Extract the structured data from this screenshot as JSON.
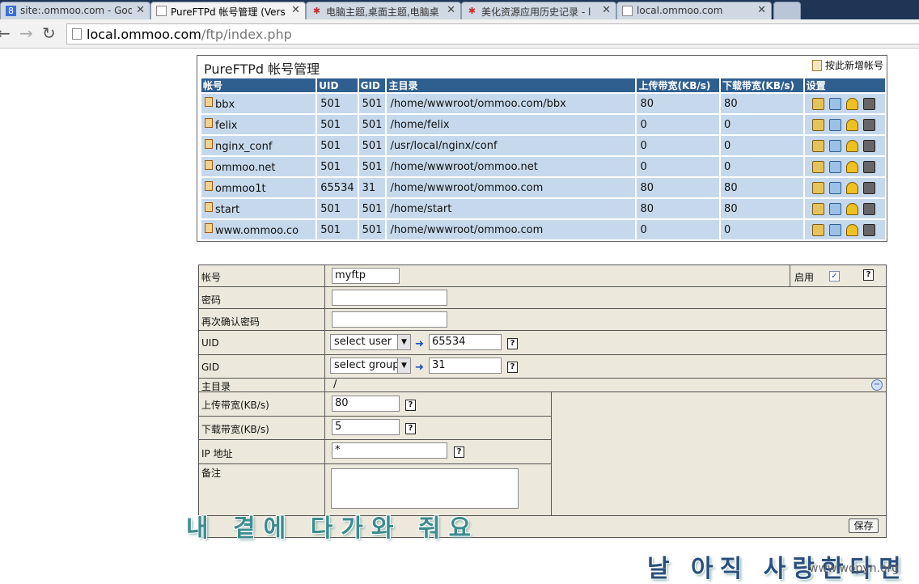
{
  "browser": {
    "tabs": [
      {
        "label": "site:.ommoo.com - Goo",
        "icon": "google-icon",
        "active": false
      },
      {
        "label": "PureFTPd 帐号管理 (Vers",
        "icon": "page-icon",
        "active": true
      },
      {
        "label": "电脑主题,桌面主题,电脑桌",
        "icon": "star-icon",
        "active": false
      },
      {
        "label": "美化资源应用历史记录 - l",
        "icon": "star-icon",
        "active": false
      },
      {
        "label": "local.ommoo.com",
        "icon": "page-icon",
        "active": false
      }
    ],
    "close": "✕",
    "url_host": "local.ommoo.com",
    "url_path": "/ftp/index.php"
  },
  "list": {
    "title": "PureFTPd 帐号管理",
    "add_label": "按此新增帐号",
    "headers": [
      "帐号",
      "UID",
      "GID",
      "主目录",
      "上传带宽(KB/s)",
      "下载带宽(KB/s)",
      "设置"
    ],
    "rows": [
      [
        "bbx",
        "501",
        "501",
        "/home/wwwroot/ommoo.com/bbx",
        "80",
        "80"
      ],
      [
        "felix",
        "501",
        "501",
        "/home/felix",
        "0",
        "0"
      ],
      [
        "nginx_conf",
        "501",
        "501",
        "/usr/local/nginx/conf",
        "0",
        "0"
      ],
      [
        "ommoo.net",
        "501",
        "501",
        "/home/wwwroot/ommoo.net",
        "0",
        "0"
      ],
      [
        "ommoo1t",
        "65534",
        "31",
        "/home/wwwroot/ommoo.com",
        "80",
        "80"
      ],
      [
        "start",
        "501",
        "501",
        "/home/start",
        "80",
        "80"
      ],
      [
        "www.ommoo.co",
        "501",
        "501",
        "/home/wwwroot/ommoo.com",
        "0",
        "0"
      ]
    ]
  },
  "form": {
    "account_label": "帐号",
    "account_value": "myftp",
    "enable_label": "启用",
    "enabled": true,
    "password_label": "密码",
    "password_value": "",
    "confirm_label": "再次确认密码",
    "confirm_value": "",
    "uid_label": "UID",
    "uid_select": "select user",
    "uid_value": "65534",
    "gid_label": "GID",
    "gid_select": "select group",
    "gid_value": "31",
    "home_label": "主目录",
    "home_value": "/",
    "upload_label": "上传带宽(KB/s)",
    "upload_value": "80",
    "download_label": "下载带宽(KB/s)",
    "download_value": "5",
    "ip_label": "IP 地址",
    "ip_value": "*",
    "note_label": "备注",
    "save_label": "保存",
    "help_glyph": "?"
  },
  "overlay": {
    "lyric1": "내 곁에 다가와 줘요",
    "lyric2": "날 아직 사랑한다면",
    "watermark": "www.wopyn.org"
  }
}
